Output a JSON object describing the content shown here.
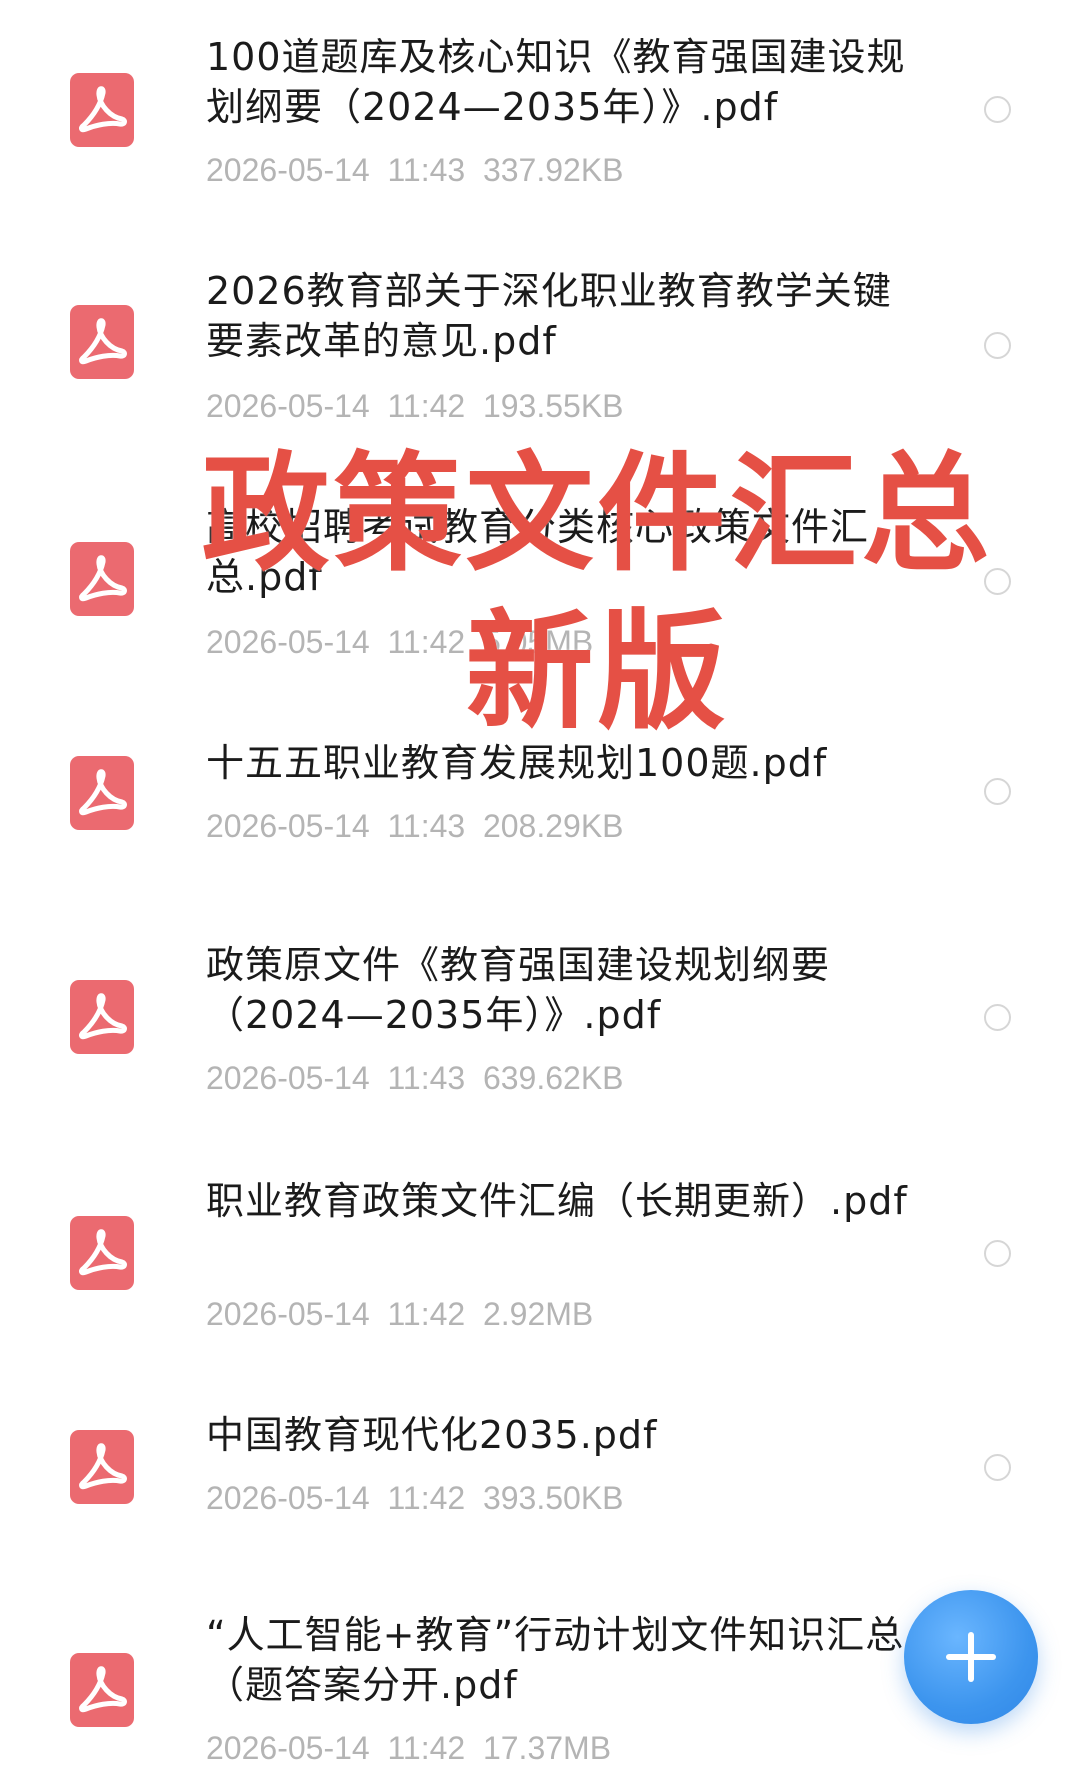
{
  "files": [
    {
      "name": "100道题库及核心知识《教育强国建设规划纲要（2024—2035年）》.pdf",
      "date": "2026-05-14",
      "time": "11:43",
      "size": "337.92KB",
      "icon": "pdf-icon"
    },
    {
      "name": "2026教育部关于深化职业教育教学关键要素改革的意见.pdf",
      "date": "2026-05-14",
      "time": "11:42",
      "size": "193.55KB",
      "icon": "pdf-icon"
    },
    {
      "name": "高校招聘考试教育分类核心政策文件汇总.pdf",
      "date": "2026-05-14",
      "time": "11:42",
      "size": "5.05MB",
      "icon": "pdf-icon"
    },
    {
      "name": "十五五职业教育发展规划100题.pdf",
      "date": "2026-05-14",
      "time": "11:43",
      "size": "208.29KB",
      "icon": "pdf-icon"
    },
    {
      "name": "政策原文件《教育强国建设规划纲要（2024—2035年）》.pdf",
      "date": "2026-05-14",
      "time": "11:43",
      "size": "639.62KB",
      "icon": "pdf-icon"
    },
    {
      "name": "职业教育政策文件汇编（长期更新）.pdf",
      "date": "2026-05-14",
      "time": "11:42",
      "size": "2.92MB",
      "icon": "pdf-icon"
    },
    {
      "name": "中国教育现代化2035.pdf",
      "date": "2026-05-14",
      "time": "11:42",
      "size": "393.50KB",
      "icon": "pdf-icon"
    },
    {
      "name": "“人工智能+教育”行动计划文件知识汇总（题答案分开.pdf",
      "date": "2026-05-14",
      "time": "11:42",
      "size": "17.37MB",
      "icon": "pdf-icon"
    }
  ],
  "overlay": {
    "line1": "政策文件汇总",
    "line2": "新版"
  },
  "fab": {
    "icon": "plus-icon"
  },
  "colors": {
    "pdf_icon": "#eb6a70",
    "overlay_text": "#e55045",
    "fab": "#3d95ee",
    "meta_text": "#b4b4b4"
  }
}
